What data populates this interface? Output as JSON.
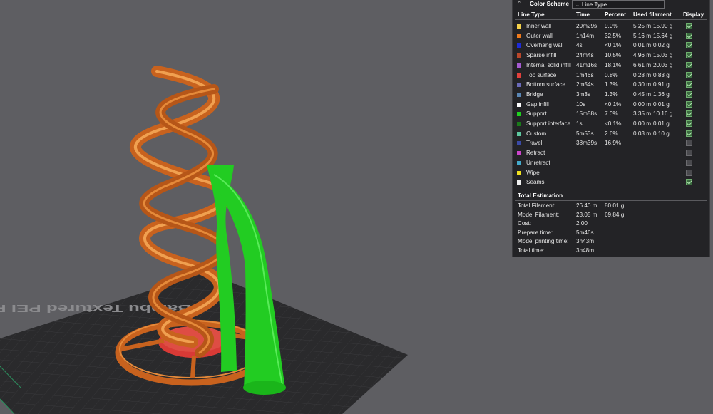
{
  "legend": {
    "title": "Color Scheme",
    "scheme_value": "Line Type",
    "columns": {
      "line_type": "Line Type",
      "time": "Time",
      "percent": "Percent",
      "used_filament": "Used filament",
      "display": "Display"
    },
    "rows": [
      {
        "name": "Inner wall",
        "color": "#f5d24a",
        "time": "20m29s",
        "percent": "9.0%",
        "len": "5.25 m",
        "weight": "15.90 g",
        "display": true
      },
      {
        "name": "Outer wall",
        "color": "#ef7a1c",
        "time": "1h14m",
        "percent": "32.5%",
        "len": "5.16 m",
        "weight": "15.64 g",
        "display": true
      },
      {
        "name": "Overhang wall",
        "color": "#1e2bd8",
        "time": "4s",
        "percent": "<0.1%",
        "len": "0.01 m",
        "weight": "0.02 g",
        "display": true
      },
      {
        "name": "Sparse infill",
        "color": "#b8462a",
        "time": "24m4s",
        "percent": "10.5%",
        "len": "4.96 m",
        "weight": "15.03 g",
        "display": true
      },
      {
        "name": "Internal solid infill",
        "color": "#a45ad0",
        "time": "41m16s",
        "percent": "18.1%",
        "len": "6.61 m",
        "weight": "20.03 g",
        "display": true
      },
      {
        "name": "Top surface",
        "color": "#e0403c",
        "time": "1m46s",
        "percent": "0.8%",
        "len": "0.28 m",
        "weight": "0.83 g",
        "display": true
      },
      {
        "name": "Bottom surface",
        "color": "#6a6ab8",
        "time": "2m54s",
        "percent": "1.3%",
        "len": "0.30 m",
        "weight": "0.91 g",
        "display": true
      },
      {
        "name": "Bridge",
        "color": "#5a86b4",
        "time": "3m3s",
        "percent": "1.3%",
        "len": "0.45 m",
        "weight": "1.36 g",
        "display": true
      },
      {
        "name": "Gap infill",
        "color": "#ffffff",
        "time": "10s",
        "percent": "<0.1%",
        "len": "0.00 m",
        "weight": "0.01 g",
        "display": true
      },
      {
        "name": "Support",
        "color": "#20d020",
        "time": "15m58s",
        "percent": "7.0%",
        "len": "3.35 m",
        "weight": "10.16 g",
        "display": true
      },
      {
        "name": "Support interface",
        "color": "#1a7a1a",
        "time": "1s",
        "percent": "<0.1%",
        "len": "0.00 m",
        "weight": "0.01 g",
        "display": true
      },
      {
        "name": "Custom",
        "color": "#5ec8a0",
        "time": "5m53s",
        "percent": "2.6%",
        "len": "0.03 m",
        "weight": "0.10 g",
        "display": true
      },
      {
        "name": "Travel",
        "color": "#3a4aa6",
        "time": "38m39s",
        "percent": "16.9%",
        "len": "",
        "weight": "",
        "display": false
      },
      {
        "name": "Retract",
        "color": "#cc44cc",
        "time": "",
        "percent": "",
        "len": "",
        "weight": "",
        "display": false
      },
      {
        "name": "Unretract",
        "color": "#44aacc",
        "time": "",
        "percent": "",
        "len": "",
        "weight": "",
        "display": false
      },
      {
        "name": "Wipe",
        "color": "#f0e020",
        "time": "",
        "percent": "",
        "len": "",
        "weight": "",
        "display": false
      },
      {
        "name": "Seams",
        "color": "#f0f0f0",
        "time": "",
        "percent": "",
        "len": "",
        "weight": "",
        "display": true
      }
    ],
    "total_title": "Total Estimation",
    "totals": [
      {
        "label": "Total Filament:",
        "value": "26.40 m",
        "extra": "80.01 g"
      },
      {
        "label": "Model Filament:",
        "value": "23.05 m",
        "extra": "69.84 g"
      },
      {
        "label": "Cost:",
        "value": "2.00",
        "extra": ""
      },
      {
        "label": "Prepare time:",
        "value": "5m46s",
        "extra": ""
      },
      {
        "label": "Model printing time:",
        "value": "3h43m",
        "extra": ""
      },
      {
        "label": "Total time:",
        "value": "3h48m",
        "extra": ""
      }
    ]
  },
  "scene": {
    "plate_text": "Bambu Textured PEI Plate",
    "colors": {
      "outer_wall": "#d9762a",
      "support": "#22cc22",
      "top_surface": "#d83a36",
      "plate": "#2a2a2c"
    }
  }
}
